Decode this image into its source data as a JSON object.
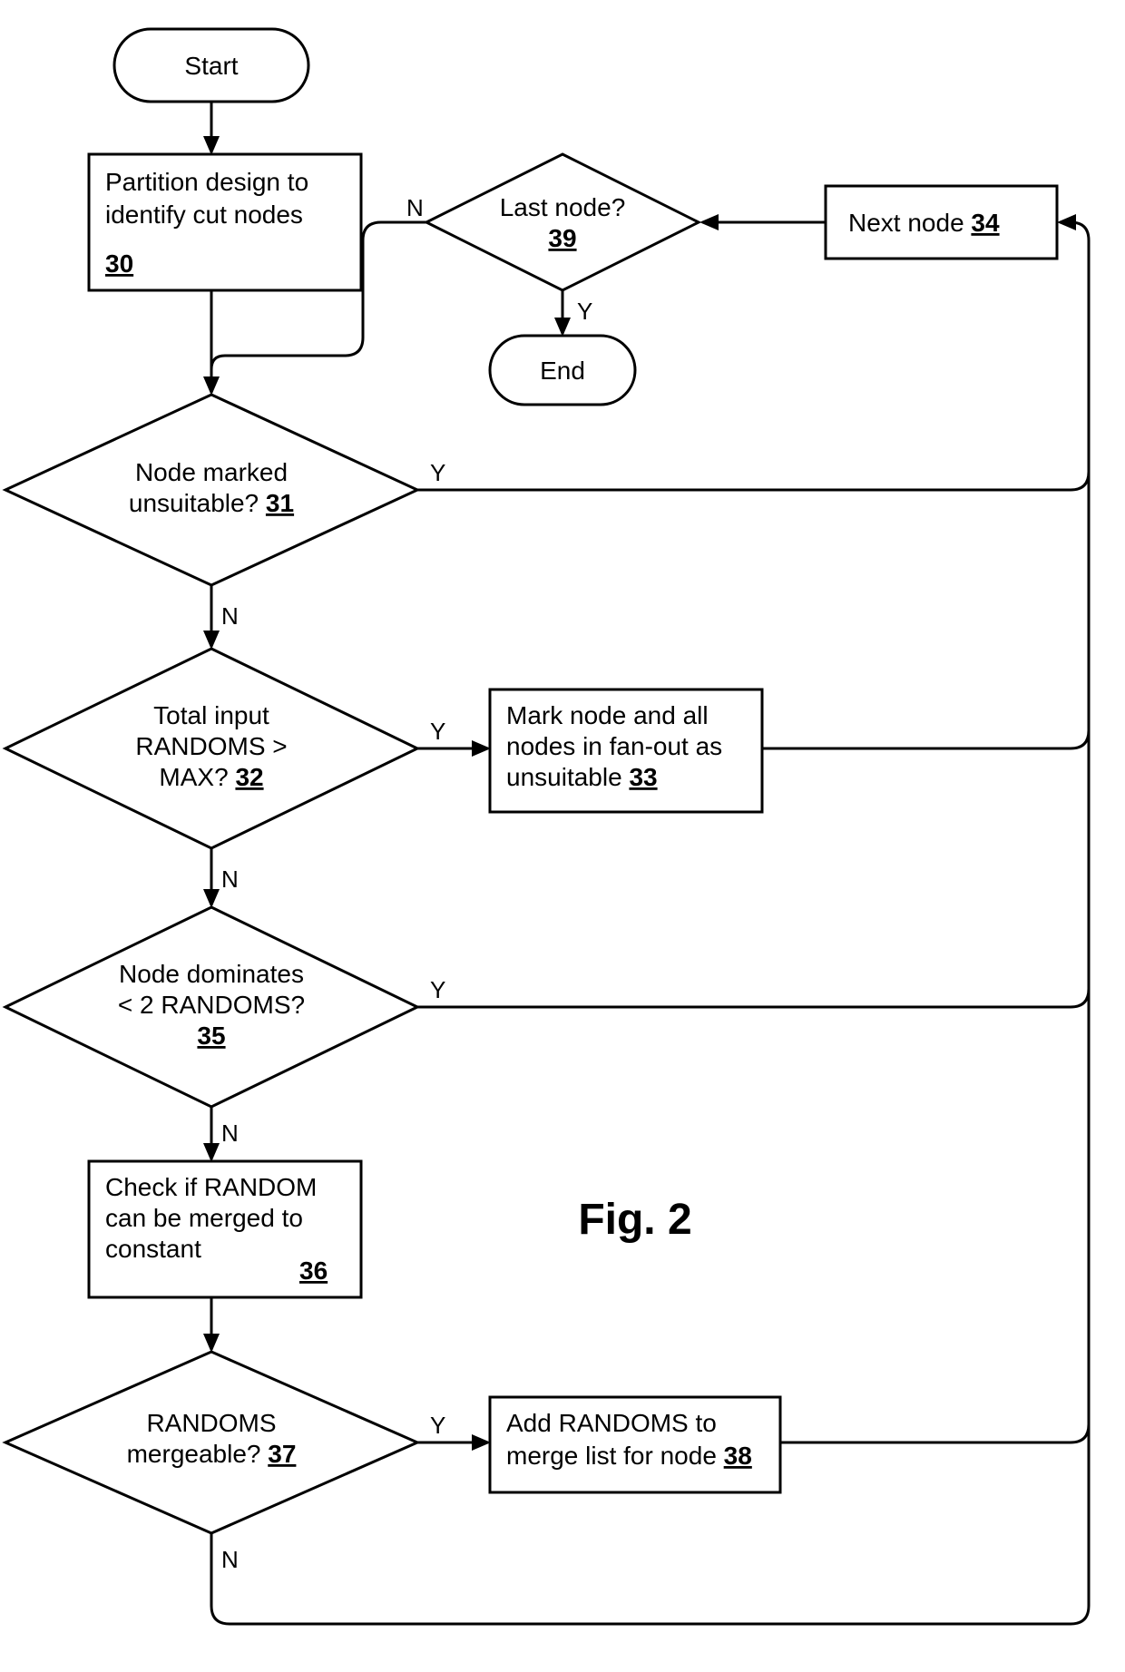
{
  "figure_title": "Fig. 2",
  "labels": {
    "Y": "Y",
    "N": "N"
  },
  "nodes": {
    "start": {
      "text": "Start"
    },
    "end": {
      "text": "End"
    },
    "n30": {
      "line1": "Partition design to",
      "line2": "identify cut nodes",
      "ref": "30"
    },
    "n31": {
      "line1": "Node marked",
      "line2": "unsuitable?",
      "ref": "31"
    },
    "n32": {
      "line1": "Total input",
      "line2": "RANDOMS >",
      "line3": "MAX?",
      "ref": "32"
    },
    "n33": {
      "line1": "Mark node and all",
      "line2": "nodes in fan-out as",
      "line3a": "unsuitable",
      "ref": "33"
    },
    "n34": {
      "line1": "Next node",
      "ref": "34"
    },
    "n35": {
      "line1": "Node dominates",
      "line2": "< 2 RANDOMS?",
      "ref": "35"
    },
    "n36": {
      "line1": "Check if RANDOM",
      "line2": "can be merged to",
      "line3": "constant",
      "ref": "36"
    },
    "n37": {
      "line1": "RANDOMS",
      "line2": "mergeable?",
      "ref": "37"
    },
    "n38": {
      "line1": "Add RANDOMS to",
      "line2a": "merge list for node",
      "ref": "38"
    },
    "n39": {
      "line1": "Last node?",
      "ref": "39"
    }
  },
  "chart_data": {
    "type": "flowchart",
    "title": "Fig. 2",
    "nodes": [
      {
        "id": "start",
        "kind": "terminator",
        "label": "Start"
      },
      {
        "id": "30",
        "kind": "process",
        "label": "Partition design to identify cut nodes"
      },
      {
        "id": "31",
        "kind": "decision",
        "label": "Node marked unsuitable?"
      },
      {
        "id": "32",
        "kind": "decision",
        "label": "Total input RANDOMS > MAX?"
      },
      {
        "id": "33",
        "kind": "process",
        "label": "Mark node and all nodes in fan-out as unsuitable"
      },
      {
        "id": "34",
        "kind": "process",
        "label": "Next node"
      },
      {
        "id": "35",
        "kind": "decision",
        "label": "Node dominates < 2 RANDOMS?"
      },
      {
        "id": "36",
        "kind": "process",
        "label": "Check if RANDOM can be merged to constant"
      },
      {
        "id": "37",
        "kind": "decision",
        "label": "RANDOMS mergeable?"
      },
      {
        "id": "38",
        "kind": "process",
        "label": "Add RANDOMS to merge list for node"
      },
      {
        "id": "39",
        "kind": "decision",
        "label": "Last node?"
      },
      {
        "id": "end",
        "kind": "terminator",
        "label": "End"
      }
    ],
    "edges": [
      {
        "from": "start",
        "to": "30"
      },
      {
        "from": "30",
        "to": "31"
      },
      {
        "from": "31",
        "to": "32",
        "label": "N"
      },
      {
        "from": "31",
        "to": "34",
        "label": "Y"
      },
      {
        "from": "32",
        "to": "35",
        "label": "N"
      },
      {
        "from": "32",
        "to": "33",
        "label": "Y"
      },
      {
        "from": "33",
        "to": "34"
      },
      {
        "from": "35",
        "to": "36",
        "label": "N"
      },
      {
        "from": "35",
        "to": "34",
        "label": "Y"
      },
      {
        "from": "36",
        "to": "37"
      },
      {
        "from": "37",
        "to": "38",
        "label": "Y"
      },
      {
        "from": "37",
        "to": "34",
        "label": "N"
      },
      {
        "from": "38",
        "to": "34"
      },
      {
        "from": "34",
        "to": "39"
      },
      {
        "from": "39",
        "to": "31",
        "label": "N"
      },
      {
        "from": "39",
        "to": "end",
        "label": "Y"
      }
    ]
  }
}
